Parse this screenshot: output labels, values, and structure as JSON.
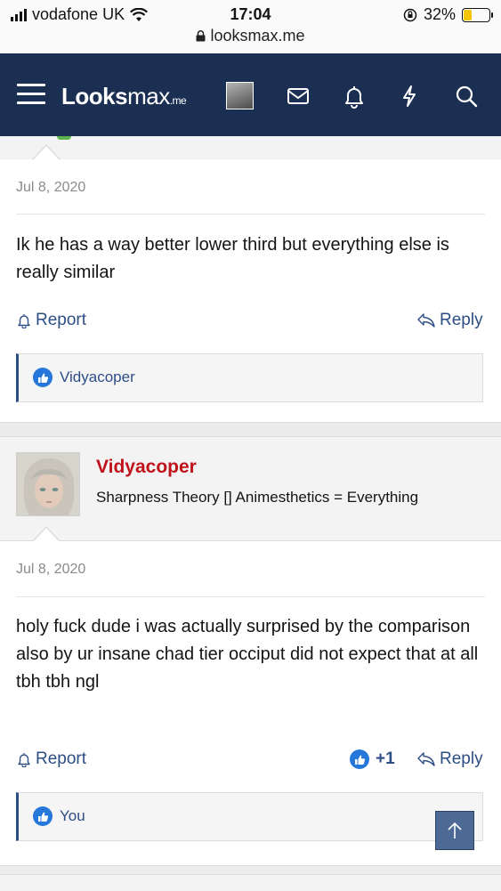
{
  "status_bar": {
    "carrier": "vodafone UK",
    "time": "17:04",
    "battery_percent": "32%",
    "url": "looksmax.me"
  },
  "header": {
    "logo_prefix": "Looks",
    "logo_main": "max",
    "logo_suffix": ".me",
    "icons": [
      "menu-icon",
      "avatar",
      "mail-icon",
      "bell-icon",
      "lightning-icon",
      "search-icon"
    ]
  },
  "posts": [
    {
      "date": "Jul 8, 2020",
      "body": "Ik he has a way better lower third but everything else is really similar",
      "report_label": "Report",
      "reply_label": "Reply",
      "reactions_label": "Vidyacoper"
    },
    {
      "author": "Vidyacoper",
      "author_title": "Sharpness Theory [] Animesthetics = Everything",
      "date": "Jul 8, 2020",
      "body_line1": "holy fuck dude i was actually surprised by the comparison",
      "body_line2": "also by ur insane chad tier occiput did not expect that at all tbh tbh ngl",
      "report_label": "Report",
      "like_count": "+1",
      "reply_label": "Reply",
      "reactions_label": "You"
    }
  ],
  "colors": {
    "navbar": "#1b2f52",
    "link": "#2d4e85",
    "username": "#c0121a",
    "like": "#2577d9"
  }
}
